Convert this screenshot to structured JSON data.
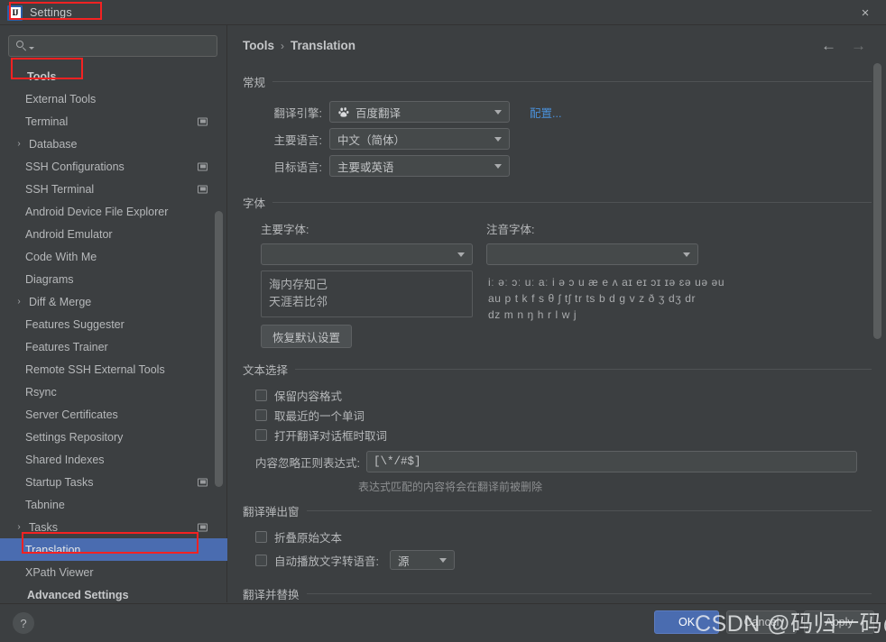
{
  "window": {
    "title": "Settings",
    "logo_text": "IJ",
    "close_label": "×"
  },
  "sidebar": {
    "search": {
      "value": "",
      "placeholder": ""
    },
    "search_icon": "search-icon",
    "items": [
      {
        "label": "Tools",
        "type": "group",
        "arrow": "",
        "badge": false,
        "selected": false
      },
      {
        "label": "External Tools",
        "type": "child",
        "arrow": "",
        "badge": false,
        "selected": false
      },
      {
        "label": "Terminal",
        "type": "child",
        "arrow": "",
        "badge": true,
        "selected": false
      },
      {
        "label": "Database",
        "type": "parent",
        "arrow": "›",
        "badge": false,
        "selected": false
      },
      {
        "label": "SSH Configurations",
        "type": "child",
        "arrow": "",
        "badge": true,
        "selected": false
      },
      {
        "label": "SSH Terminal",
        "type": "child",
        "arrow": "",
        "badge": true,
        "selected": false
      },
      {
        "label": "Android Device File Explorer",
        "type": "child",
        "arrow": "",
        "badge": false,
        "selected": false
      },
      {
        "label": "Android Emulator",
        "type": "child",
        "arrow": "",
        "badge": false,
        "selected": false
      },
      {
        "label": "Code With Me",
        "type": "child",
        "arrow": "",
        "badge": false,
        "selected": false
      },
      {
        "label": "Diagrams",
        "type": "child",
        "arrow": "",
        "badge": false,
        "selected": false
      },
      {
        "label": "Diff & Merge",
        "type": "parent",
        "arrow": "›",
        "badge": false,
        "selected": false
      },
      {
        "label": "Features Suggester",
        "type": "child",
        "arrow": "",
        "badge": false,
        "selected": false
      },
      {
        "label": "Features Trainer",
        "type": "child",
        "arrow": "",
        "badge": false,
        "selected": false
      },
      {
        "label": "Remote SSH External Tools",
        "type": "child",
        "arrow": "",
        "badge": false,
        "selected": false
      },
      {
        "label": "Rsync",
        "type": "child",
        "arrow": "",
        "badge": false,
        "selected": false
      },
      {
        "label": "Server Certificates",
        "type": "child",
        "arrow": "",
        "badge": false,
        "selected": false
      },
      {
        "label": "Settings Repository",
        "type": "child",
        "arrow": "",
        "badge": false,
        "selected": false
      },
      {
        "label": "Shared Indexes",
        "type": "child",
        "arrow": "",
        "badge": false,
        "selected": false
      },
      {
        "label": "Startup Tasks",
        "type": "child",
        "arrow": "",
        "badge": true,
        "selected": false
      },
      {
        "label": "Tabnine",
        "type": "child",
        "arrow": "",
        "badge": false,
        "selected": false
      },
      {
        "label": "Tasks",
        "type": "parent",
        "arrow": "›",
        "badge": true,
        "selected": false
      },
      {
        "label": "Translation",
        "type": "child",
        "arrow": "",
        "badge": false,
        "selected": true
      },
      {
        "label": "XPath Viewer",
        "type": "child",
        "arrow": "",
        "badge": false,
        "selected": false
      },
      {
        "label": "Advanced Settings",
        "type": "group",
        "arrow": "",
        "badge": false,
        "selected": false
      }
    ]
  },
  "content": {
    "breadcrumb": {
      "root": "Tools",
      "separator": "›",
      "leaf": "Translation"
    },
    "nav": {
      "back": "←",
      "forward": "→"
    },
    "general": {
      "section_title": "常规",
      "engine_label": "翻译引擎:",
      "engine_value": "百度翻译",
      "engine_icon": "baidu-paw-icon",
      "configure_link": "配置...",
      "primary_lang_label": "主要语言:",
      "primary_lang_value": "中文（简体）",
      "target_lang_label": "目标语言:",
      "target_lang_value": "主要或英语"
    },
    "font": {
      "section_title": "字体",
      "primary_font_label": "主要字体:",
      "primary_font_value": "",
      "phonetic_font_label": "注音字体:",
      "phonetic_font_value": "",
      "preview_line1": "海内存知己",
      "preview_line2": "天涯若比邻",
      "phonetic_line1": "iː əː ɔː uː aː i ə ɔ u æ e ʌ aɪ eɪ ɔɪ ɪə ɛə uə əu",
      "phonetic_line2": "au p t k f s θ ʃ tʃ tr ts b d g v z ð ʒ dʒ dr",
      "phonetic_line3": "dz m n ŋ h r l w j",
      "reset_button": "恢复默认设置"
    },
    "text_selection": {
      "section_title": "文本选择",
      "checkboxes": [
        {
          "label": "保留内容格式",
          "checked": false
        },
        {
          "label": "取最近的一个单词",
          "checked": false
        },
        {
          "label": "打开翻译对话框时取词",
          "checked": false
        }
      ],
      "regex_label": "内容忽略正则表达式:",
      "regex_value": "[\\*/#$]",
      "regex_hint": "表达式匹配的内容将会在翻译前被删除"
    },
    "popup": {
      "section_title": "翻译弹出窗",
      "fold_checkbox": {
        "label": "折叠原始文本",
        "checked": false
      },
      "tts_checkbox": {
        "label": "自动播放文字转语音:",
        "checked": false
      },
      "tts_value": "源"
    },
    "replace": {
      "section_title": "翻译并替换"
    }
  },
  "footer": {
    "help": "?",
    "ok": "OK",
    "cancel": "Cancel",
    "apply": "Apply",
    "watermark": "CSDN @码归一码@"
  }
}
